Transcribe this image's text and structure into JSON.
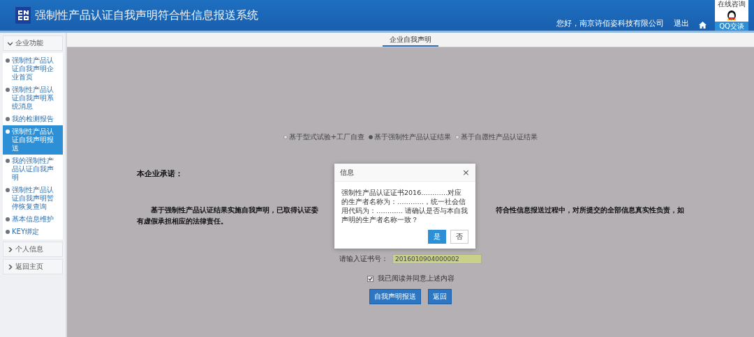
{
  "header": {
    "title": "强制性产品认证自我声明符合性信息报送系统",
    "greeting": "您好，南京诗佰姿科技有限公司",
    "logout": "退出",
    "qq": {
      "caption": "在线咨询",
      "button": "QQ交谈"
    }
  },
  "sidebar": {
    "sections": [
      {
        "label": "企业功能",
        "expanded": true,
        "items": [
          {
            "label": "强制性产品认证自我声明企业首页",
            "selected": false
          },
          {
            "label": "强制性产品认证自我声明系统消息",
            "selected": false
          },
          {
            "label": "我的检测报告",
            "selected": false
          },
          {
            "label": "强制性产品认证自我声明报送",
            "selected": true
          },
          {
            "label": "我的强制性产品认证自我声明",
            "selected": false
          },
          {
            "label": "强制性产品认证自我声明暂停恢复查询",
            "selected": false
          },
          {
            "label": "基本信息维护",
            "selected": false
          },
          {
            "label": "KEY绑定",
            "selected": false
          }
        ]
      },
      {
        "label": "个人信息",
        "expanded": false
      },
      {
        "label": "返回主页",
        "expanded": false
      }
    ]
  },
  "main": {
    "tab": "企业自我声明",
    "options": [
      {
        "label": "基于型式试验+工厂自查",
        "selected": false
      },
      {
        "label": "基于强制性产品认证结果",
        "selected": true
      },
      {
        "label": "基于自愿性产品认证结果",
        "selected": false
      }
    ],
    "commitment_heading": "本企业承诺：",
    "commitment_line_1_left": "基于强制性产品认证结果实施自我声明，已取得认证委",
    "commitment_line_1_right": "符合性信息报送过程中，对所提交的全部信息真实性负责，如",
    "commitment_line_2": "有虚假承担相应的法律责任。",
    "certificate_label": "请输入证书号：",
    "certificate_value": "2016010904000002",
    "agree": {
      "label": "我已阅读并同意上述内容",
      "checked": true
    },
    "buttons": [
      "自我声明报送",
      "返回"
    ]
  },
  "dialog": {
    "title": "信息",
    "close": "×",
    "message": "强制性产品认证证书2016…………对应的生产者名称为：…………，统一社会信用代码为：………… 请确认是否与本自我声明的生产者名称一致？",
    "buttons": [
      {
        "label": "是",
        "kind": "primary"
      },
      {
        "label": "否",
        "kind": "plain"
      }
    ]
  }
}
